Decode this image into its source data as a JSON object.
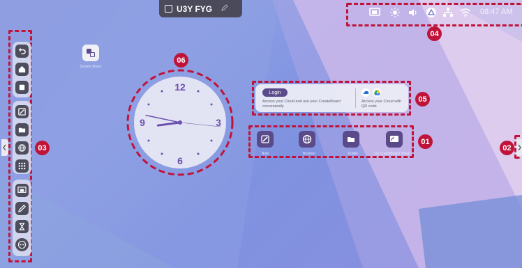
{
  "title_bar": {
    "code": "U3Y FYG"
  },
  "status_bar": {
    "time": "08:47 AM",
    "icons": [
      "screen-share-icon",
      "brightness-icon",
      "volume-icon",
      "cloud-icon",
      "network-icon",
      "wifi-icon"
    ]
  },
  "desktop": {
    "shortcut_label": "Screen Share"
  },
  "clock": {
    "hours": [
      "12",
      "3",
      "6",
      "9"
    ],
    "hour": 8.75,
    "minute": 47
  },
  "widget": {
    "login_label": "Login",
    "left_text": "Access your Cloud and use your CreateBoard conveniently",
    "right_text": "Access your Cloud with QR code"
  },
  "apps": [
    {
      "label": "Note",
      "icon": "note-icon",
      "color": "#5a4a8a"
    },
    {
      "label": "Browser",
      "icon": "browser-icon",
      "color": "#5a4a8a"
    },
    {
      "label": "Folder",
      "icon": "folder-icon",
      "color": "#5a4a8a"
    },
    {
      "label": "LG CreateBoard Share",
      "icon": "screen-share-icon",
      "color": "#5a4a8a"
    }
  ],
  "callouts": [
    "01",
    "02",
    "03",
    "04",
    "05",
    "06"
  ],
  "colors": {
    "callout": "#c0133a",
    "accent": "#5a4a8a",
    "clock_hand": "#6a4fb0"
  }
}
